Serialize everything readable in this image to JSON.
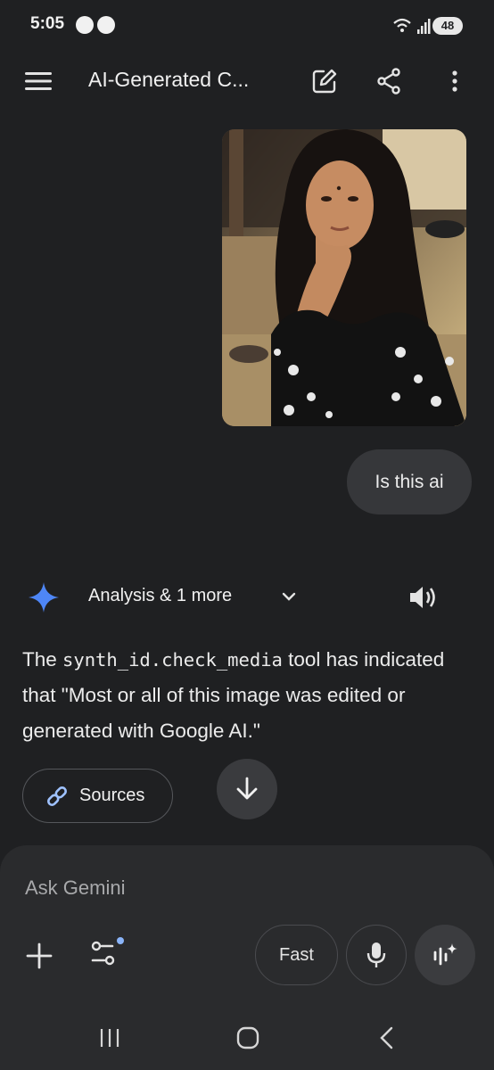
{
  "status_bar": {
    "time": "5:05",
    "battery": "48"
  },
  "app_bar": {
    "title": "AI-Generated C...",
    "menu_icon": "menu-icon",
    "new_chat_icon": "edit-icon",
    "share_icon": "share-icon",
    "more_icon": "more-vert-icon"
  },
  "chat": {
    "user_message": "Is this ai",
    "response": {
      "header": "Analysis & 1 more",
      "text_before": "The ",
      "code": "synth_id.check_media",
      "text_after": " tool has indicated that \"Most or all of this image was edited or generated with Google AI.\"",
      "sources_label": "Sources"
    }
  },
  "composer": {
    "placeholder": "Ask Gemini",
    "mode_label": "Fast"
  },
  "colors": {
    "background": "#1f2022",
    "panel": "#2a2b2d",
    "bubble": "#36373a",
    "gemini_star": "#4e86f6",
    "badge_dot": "#8ab4f8"
  }
}
